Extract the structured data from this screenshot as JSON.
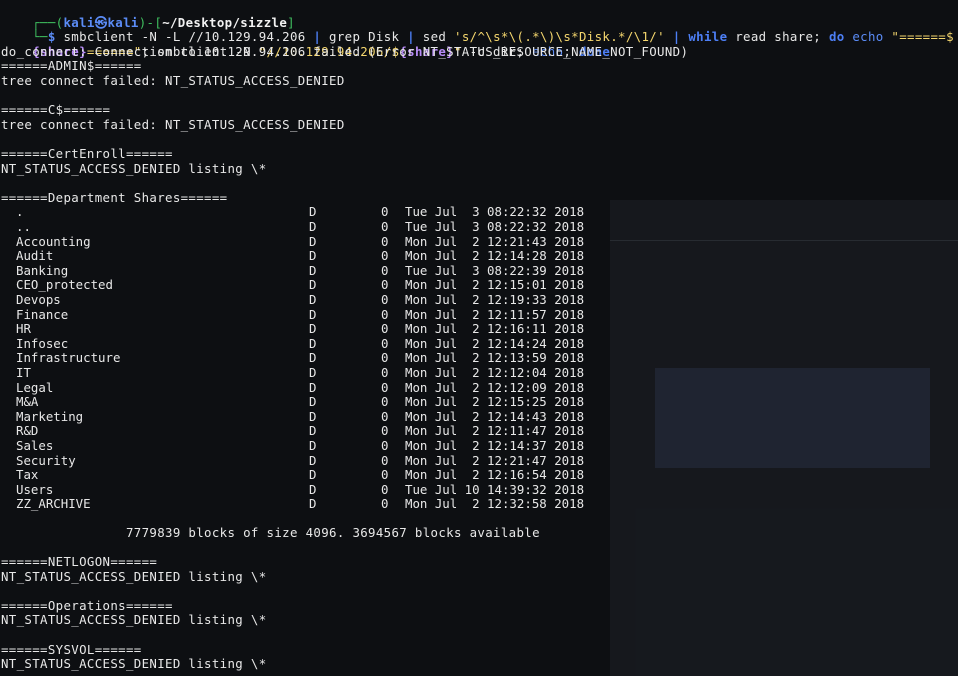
{
  "prompt": {
    "corner_top": "┌──(",
    "user": "kali",
    "at": "㉿",
    "host": "kali",
    "mid": ")-[",
    "path": "~/Desktop/sizzle",
    "end": "]",
    "corner_bottom": "└─",
    "dollar": "$"
  },
  "command": {
    "p1": " smbclient -N -L //10.129.94.206 ",
    "pipe1": "|",
    "p2": " grep Disk ",
    "pipe2": "|",
    "p3": " sed ",
    "sed_expr": "'s/^\\s*\\(.*\\)\\s*Disk.*/\\1/'",
    "p4": " ",
    "pipe3": "|",
    "kw_while": " while",
    "read": " read",
    "p5": " share; ",
    "kw_do": "do",
    "echo1": " echo ",
    "str1a": "\"======$",
    "var_share": "{share}",
    "str1b": "======\"",
    "p6": "; smbclient -N ",
    "str2a": "\"//10.129.94.206/$",
    "str2b": "\"",
    "p7": " -c dir; ",
    "echo2": "echo",
    "p8": "; ",
    "kw_done": "done"
  },
  "output_top": [
    "do_connect: Connection to 10.129.94.206 failed (Error NT_STATUS_RESOURCE_NAME_NOT_FOUND)",
    "======ADMIN$======",
    "tree connect failed: NT_STATUS_ACCESS_DENIED",
    "",
    "======C$======",
    "tree connect failed: NT_STATUS_ACCESS_DENIED",
    "",
    "======CertEnroll======",
    "NT_STATUS_ACCESS_DENIED listing \\*",
    "",
    "======Department Shares======"
  ],
  "listing": [
    {
      "name": ".",
      "type": "D",
      "size": "0",
      "date": "Tue Jul  3 08:22:32 2018"
    },
    {
      "name": "..",
      "type": "D",
      "size": "0",
      "date": "Tue Jul  3 08:22:32 2018"
    },
    {
      "name": "Accounting",
      "type": "D",
      "size": "0",
      "date": "Mon Jul  2 12:21:43 2018"
    },
    {
      "name": "Audit",
      "type": "D",
      "size": "0",
      "date": "Mon Jul  2 12:14:28 2018"
    },
    {
      "name": "Banking",
      "type": "D",
      "size": "0",
      "date": "Tue Jul  3 08:22:39 2018"
    },
    {
      "name": "CEO_protected",
      "type": "D",
      "size": "0",
      "date": "Mon Jul  2 12:15:01 2018"
    },
    {
      "name": "Devops",
      "type": "D",
      "size": "0",
      "date": "Mon Jul  2 12:19:33 2018"
    },
    {
      "name": "Finance",
      "type": "D",
      "size": "0",
      "date": "Mon Jul  2 12:11:57 2018"
    },
    {
      "name": "HR",
      "type": "D",
      "size": "0",
      "date": "Mon Jul  2 12:16:11 2018"
    },
    {
      "name": "Infosec",
      "type": "D",
      "size": "0",
      "date": "Mon Jul  2 12:14:24 2018"
    },
    {
      "name": "Infrastructure",
      "type": "D",
      "size": "0",
      "date": "Mon Jul  2 12:13:59 2018"
    },
    {
      "name": "IT",
      "type": "D",
      "size": "0",
      "date": "Mon Jul  2 12:12:04 2018"
    },
    {
      "name": "Legal",
      "type": "D",
      "size": "0",
      "date": "Mon Jul  2 12:12:09 2018"
    },
    {
      "name": "M&A",
      "type": "D",
      "size": "0",
      "date": "Mon Jul  2 12:15:25 2018"
    },
    {
      "name": "Marketing",
      "type": "D",
      "size": "0",
      "date": "Mon Jul  2 12:14:43 2018"
    },
    {
      "name": "R&D",
      "type": "D",
      "size": "0",
      "date": "Mon Jul  2 12:11:47 2018"
    },
    {
      "name": "Sales",
      "type": "D",
      "size": "0",
      "date": "Mon Jul  2 12:14:37 2018"
    },
    {
      "name": "Security",
      "type": "D",
      "size": "0",
      "date": "Mon Jul  2 12:21:47 2018"
    },
    {
      "name": "Tax",
      "type": "D",
      "size": "0",
      "date": "Mon Jul  2 12:16:54 2018"
    },
    {
      "name": "Users",
      "type": "D",
      "size": "0",
      "date": "Tue Jul 10 14:39:32 2018"
    },
    {
      "name": "ZZ_ARCHIVE",
      "type": "D",
      "size": "0",
      "date": "Mon Jul  2 12:32:58 2018"
    }
  ],
  "blocks_line": "                7779839 blocks of size 4096. 3694567 blocks available",
  "output_bottom": [
    "",
    "======NETLOGON======",
    "NT_STATUS_ACCESS_DENIED listing \\*",
    "",
    "======Operations======",
    "NT_STATUS_ACCESS_DENIED listing \\*",
    "",
    "======SYSVOL======",
    "NT_STATUS_ACCESS_DENIED listing \\*"
  ],
  "colors": {
    "background": "#0d0f12",
    "prompt_blue": "#5b8cf7",
    "string_yellow": "#f5d76e",
    "keyword_blue": "#4d7ff5",
    "variable_purple": "#b88cf7",
    "text": "#e8e8e8"
  }
}
